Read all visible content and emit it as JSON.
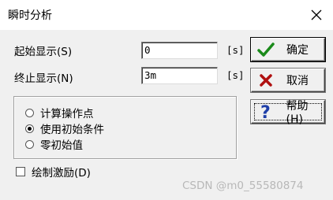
{
  "window": {
    "title": "瞬时分析",
    "close_icon": "close-icon"
  },
  "display": {
    "start_label": "起始显示(S)",
    "start_value": "0",
    "start_unit": "[s]",
    "stop_label": "终止显示(N)",
    "stop_value": "3m",
    "stop_unit": "[s]"
  },
  "mode": {
    "options": [
      {
        "label": "计算操作点",
        "selected": false
      },
      {
        "label": "使用初始条件",
        "selected": true
      },
      {
        "label": "零初始值",
        "selected": false
      }
    ]
  },
  "draw_excitation": {
    "label": "绘制激励(D)",
    "checked": false
  },
  "buttons": {
    "ok_label": "确定",
    "ok_icon": "check-icon",
    "cancel_label": "取消",
    "cancel_icon": "x-icon",
    "help_label": "帮助(H)",
    "help_icon": "question-icon"
  },
  "colors": {
    "ok_icon": "#1a8a1a",
    "cancel_icon": "#b01010",
    "help_icon": "#1f3fa8"
  },
  "watermark": "CSDN @m0_55580874"
}
